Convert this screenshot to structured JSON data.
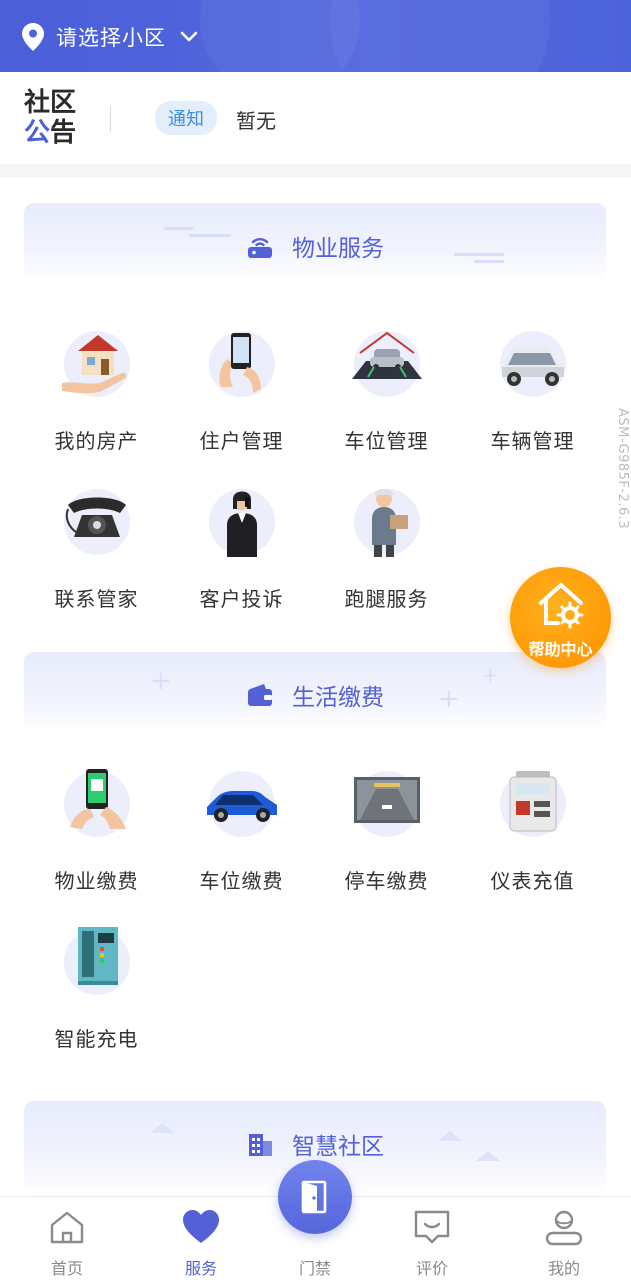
{
  "header": {
    "location_label": "请选择小区",
    "icons": {
      "location": "location-pin-icon",
      "dropdown": "chevron-down-icon"
    }
  },
  "notice": {
    "logo_line1": "社区",
    "logo_line2_accent": "公",
    "logo_line2_rest": "告",
    "tag": "通知",
    "text": "暂无"
  },
  "sections": {
    "property": {
      "title": "物业服务",
      "icon": "router-icon",
      "items": [
        {
          "label": "我的房产",
          "icon": "house-in-hand-icon"
        },
        {
          "label": "住户管理",
          "icon": "phone-in-hand-icon"
        },
        {
          "label": "车位管理",
          "icon": "parking-garage-icon"
        },
        {
          "label": "车辆管理",
          "icon": "suv-car-icon"
        },
        {
          "label": "联系管家",
          "icon": "retro-telephone-icon"
        },
        {
          "label": "客户投诉",
          "icon": "businesswoman-phone-icon"
        },
        {
          "label": "跑腿服务",
          "icon": "delivery-man-icon"
        }
      ]
    },
    "life": {
      "title": "生活缴费",
      "icon": "wallet-icon",
      "items": [
        {
          "label": "物业缴费",
          "icon": "mobile-payment-icon"
        },
        {
          "label": "车位缴费",
          "icon": "blue-car-icon"
        },
        {
          "label": "停车缴费",
          "icon": "parking-lot-icon"
        },
        {
          "label": "仪表充值",
          "icon": "electric-meter-icon"
        },
        {
          "label": "智能充电",
          "icon": "charging-station-icon"
        }
      ]
    },
    "smart": {
      "title": "智慧社区",
      "icon": "building-icon"
    }
  },
  "help": {
    "label": "帮助中心",
    "icon": "home-gear-icon"
  },
  "watermark": "ASM-G985F-2.6.3",
  "tabbar": {
    "items": [
      {
        "label": "首页",
        "icon": "home-icon",
        "active": false
      },
      {
        "label": "服务",
        "icon": "heart-icon",
        "active": true
      },
      {
        "label": "门禁",
        "icon": "door-icon",
        "active": false
      },
      {
        "label": "评价",
        "icon": "comment-icon",
        "active": false
      },
      {
        "label": "我的",
        "icon": "user-icon",
        "active": false
      }
    ]
  },
  "colors": {
    "primary": "#5461d6",
    "header_bg": "#4a5fd8",
    "help_orange": "#ff9a07",
    "tag_bg": "#e3eefb",
    "tag_text": "#3d8ee0"
  }
}
